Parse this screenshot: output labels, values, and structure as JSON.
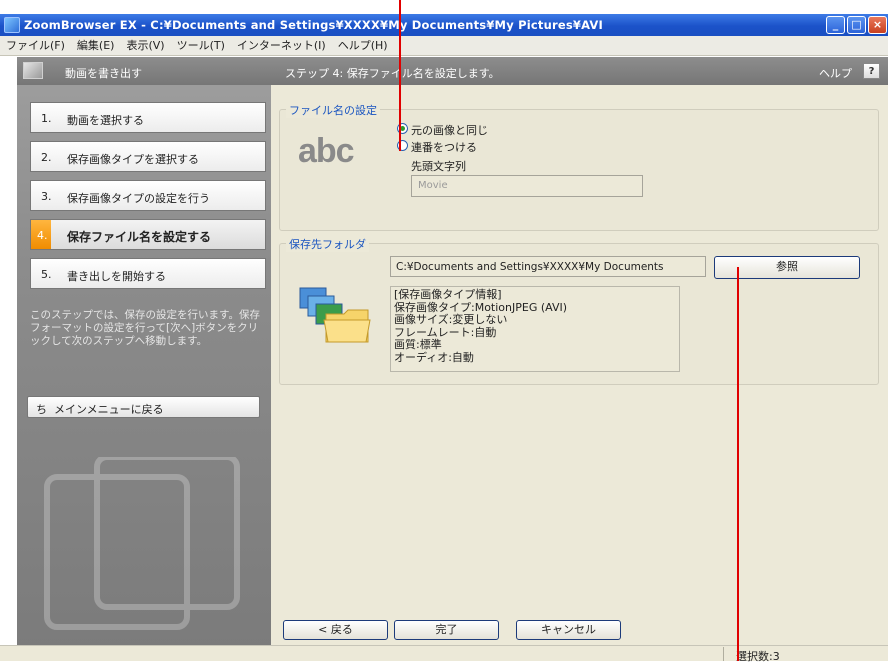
{
  "window": {
    "title": "ZoomBrowser EX - C:¥Documents and Settings¥XXXX¥My Documents¥My Pictures¥AVI",
    "minimize": "_",
    "maximize": "□",
    "close": "×"
  },
  "menu": [
    "ファイル(F)",
    "編集(E)",
    "表示(V)",
    "ツール(T)",
    "インターネット(I)",
    "ヘルプ(H)"
  ],
  "sidebar": {
    "header": "動画を書き出す",
    "steps": [
      {
        "num": "1.",
        "label": "動画を選択する"
      },
      {
        "num": "2.",
        "label": "保存画像タイプを選択する"
      },
      {
        "num": "3.",
        "label": "保存画像タイプの設定を行う"
      },
      {
        "num": "4.",
        "label": "保存ファイル名を設定する"
      },
      {
        "num": "5.",
        "label": "書き出しを開始する"
      }
    ],
    "description": "このステップでは、保存の設定を行います。保存フォーマットの設定を行って[次へ]ボタンをクリックして次のステップへ移動します。",
    "back_to_main_icon": "ち",
    "back_to_main": "メインメニューに戻る"
  },
  "main": {
    "header": "ステップ 4: 保存ファイル名を設定します。",
    "help": "ヘルプ",
    "help_icon": "?",
    "filename_group": {
      "title": "ファイル名の設定",
      "sample_text": "abc",
      "option_original": "元の画像と同じ",
      "option_serial": "連番をつける",
      "prefix_label": "先頭文字列",
      "prefix_value": "Movie"
    },
    "folder_group": {
      "title": "保存先フォルダ",
      "path": "C:¥Documents and Settings¥XXXX¥My Documents",
      "browse": "参照",
      "info_lines": [
        "[保存画像タイプ情報]",
        "保存画像タイプ:MotionJPEG (AVI)",
        "画像サイズ:変更しない",
        "フレームレート:自動",
        "画質:標準",
        "オーディオ:自動"
      ]
    },
    "buttons": {
      "back": "< 戻る",
      "finish": "完了",
      "cancel": "キャンセル"
    }
  },
  "status": {
    "selected_count": "選択数:3"
  }
}
